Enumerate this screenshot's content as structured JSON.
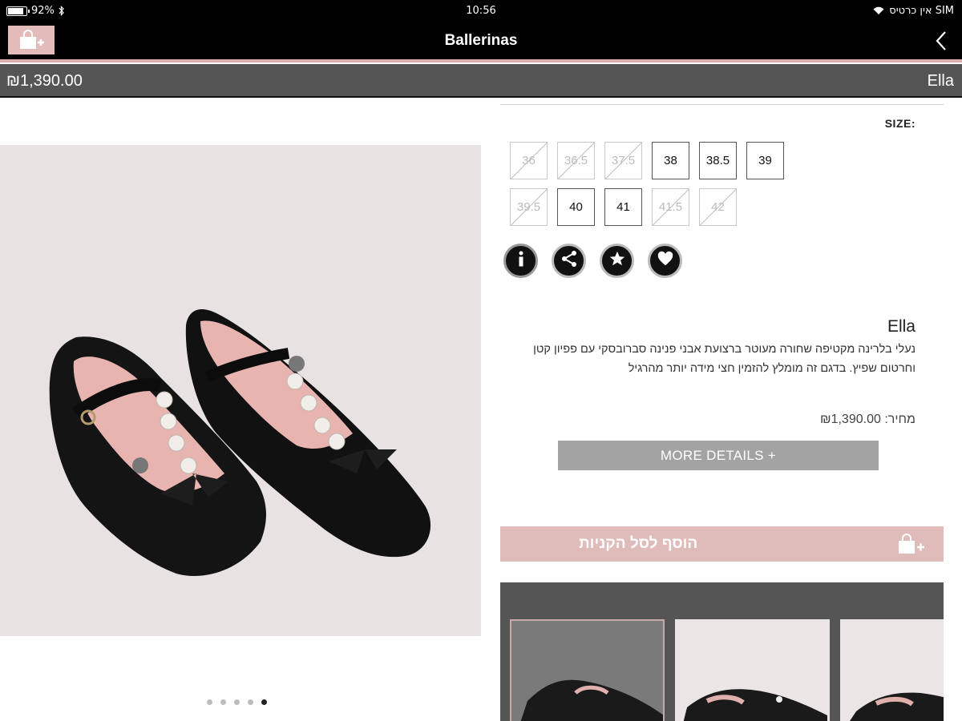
{
  "status_bar": {
    "battery": "92%",
    "time": "10:56",
    "carrier": "אין כרטיס SIM",
    "battery_level": 0.92
  },
  "nav": {
    "title": "Ballerinas"
  },
  "price_bar": {
    "price": "₪1,390.00",
    "name": "Ella"
  },
  "gallery": {
    "page_count": 5,
    "active_page": 5
  },
  "sizes": {
    "label": "SIZE:",
    "rows": [
      [
        {
          "value": "36",
          "available": false
        },
        {
          "value": "36.5",
          "available": false
        },
        {
          "value": "37.5",
          "available": false
        },
        {
          "value": "38",
          "available": true
        },
        {
          "value": "38.5",
          "available": true
        },
        {
          "value": "39",
          "available": true
        }
      ],
      [
        {
          "value": "39.5",
          "available": false
        },
        {
          "value": "40",
          "available": true
        },
        {
          "value": "41",
          "available": true
        },
        {
          "value": "41.5",
          "available": false
        },
        {
          "value": "42",
          "available": false
        }
      ]
    ]
  },
  "actions": [
    {
      "name": "info-icon",
      "icon": "info"
    },
    {
      "name": "share-icon",
      "icon": "share"
    },
    {
      "name": "star-icon",
      "icon": "star"
    },
    {
      "name": "heart-icon",
      "icon": "heart"
    }
  ],
  "product": {
    "name": "Ella",
    "description": "נעלי בלרינה מקטיפה שחורה מעוטר ברצועת אבני פנינה סברובסקי עם פפיון קטן וחרטום שפיץ. בדגם זה מומלץ להזמין חצי מידה יותר מהרגיל",
    "price": "מחיר: ₪1,390.00",
    "more_details": "MORE DETAILS +"
  },
  "cart": {
    "add_label": "הוסף לסל הקניות"
  },
  "colors": {
    "accent_pink": "#dfbcba",
    "bar_gray": "#555555"
  }
}
